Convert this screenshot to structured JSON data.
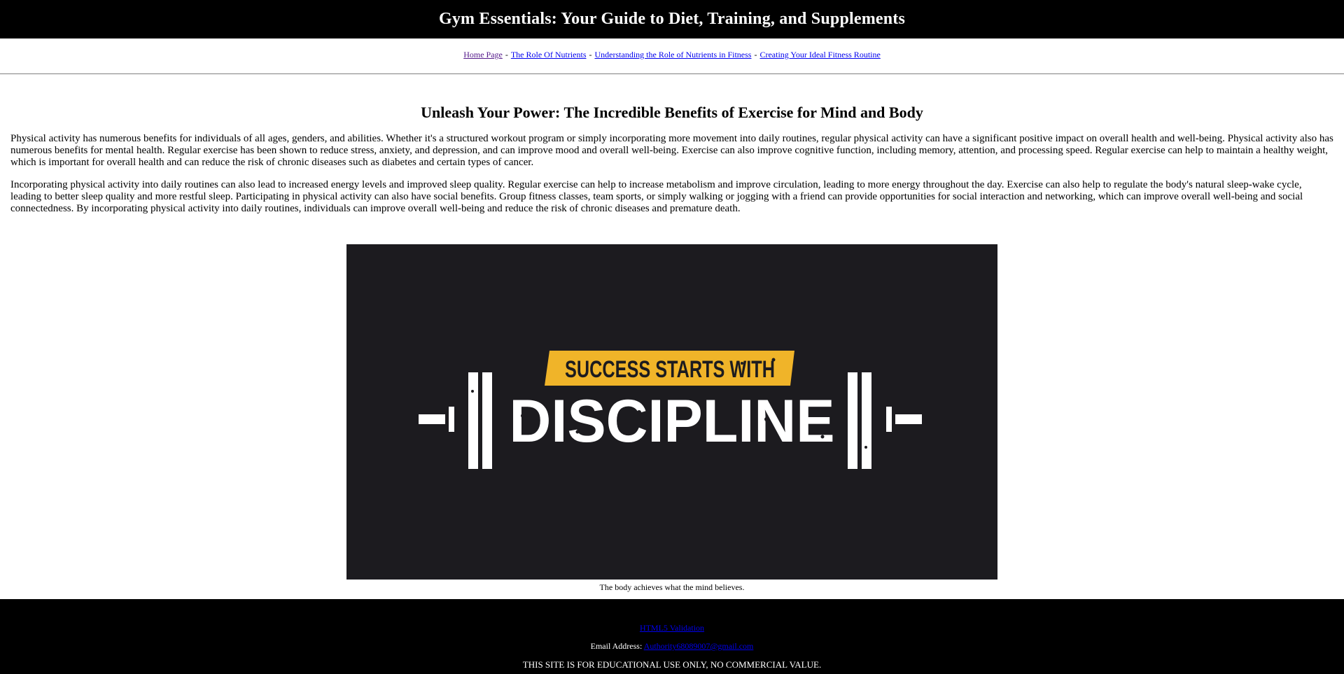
{
  "header": {
    "title": "Gym Essentials: Your Guide to Diet, Training, and Supplements"
  },
  "breadcrumb": {
    "items": [
      {
        "label": "Home Page"
      },
      {
        "label": "The Role Of Nutrients"
      },
      {
        "label": "Understanding the Role of Nutrients in Fitness"
      },
      {
        "label": "Creating Your Ideal Fitness Routine"
      }
    ],
    "separator": "-"
  },
  "article": {
    "title": "Unleash Your Power: The Incredible Benefits of Exercise for Mind and Body",
    "paragraphs": [
      "Physical activity has numerous benefits for individuals of all ages, genders, and abilities. Whether it's a structured workout program or simply incorporating more movement into daily routines, regular physical activity can have a significant positive impact on overall health and well-being. Physical activity also has numerous benefits for mental health. Regular exercise has been shown to reduce stress, anxiety, and depression, and can improve mood and overall well-being. Exercise can also improve cognitive function, including memory, attention, and processing speed. Regular exercise can help to maintain a healthy weight, which is important for overall health and can reduce the risk of chronic diseases such as diabetes and certain types of cancer.",
      "Incorporating physical activity into daily routines can also lead to increased energy levels and improved sleep quality. Regular exercise can help to increase metabolism and improve circulation, leading to more energy throughout the day. Exercise can also help to regulate the body's natural sleep-wake cycle, leading to better sleep quality and more restful sleep. Participating in physical activity can also have social benefits. Group fitness classes, team sports, or simply walking or jogging with a friend can provide opportunities for social interaction and networking, which can improve overall well-being and social connectedness. By incorporating physical activity into daily routines, individuals can improve overall well-being and reduce the risk of chronic diseases and premature death."
    ]
  },
  "figure": {
    "banner_text": "SUCCESS STARTS WITH",
    "main_text": "DISCIPLINE",
    "caption": "The body achieves what the mind believes.",
    "colors": {
      "background": "#1c1b1f",
      "banner": "#f0b429",
      "text": "#ffffff"
    }
  },
  "footer": {
    "validation_link": "HTML5 Validation",
    "email_label": "Email Address:",
    "email_link": "Authority68089007@gmail.com",
    "notice": "THIS SITE IS FOR EDUCATIONAL USE ONLY, NO COMMERCIAL VALUE."
  }
}
